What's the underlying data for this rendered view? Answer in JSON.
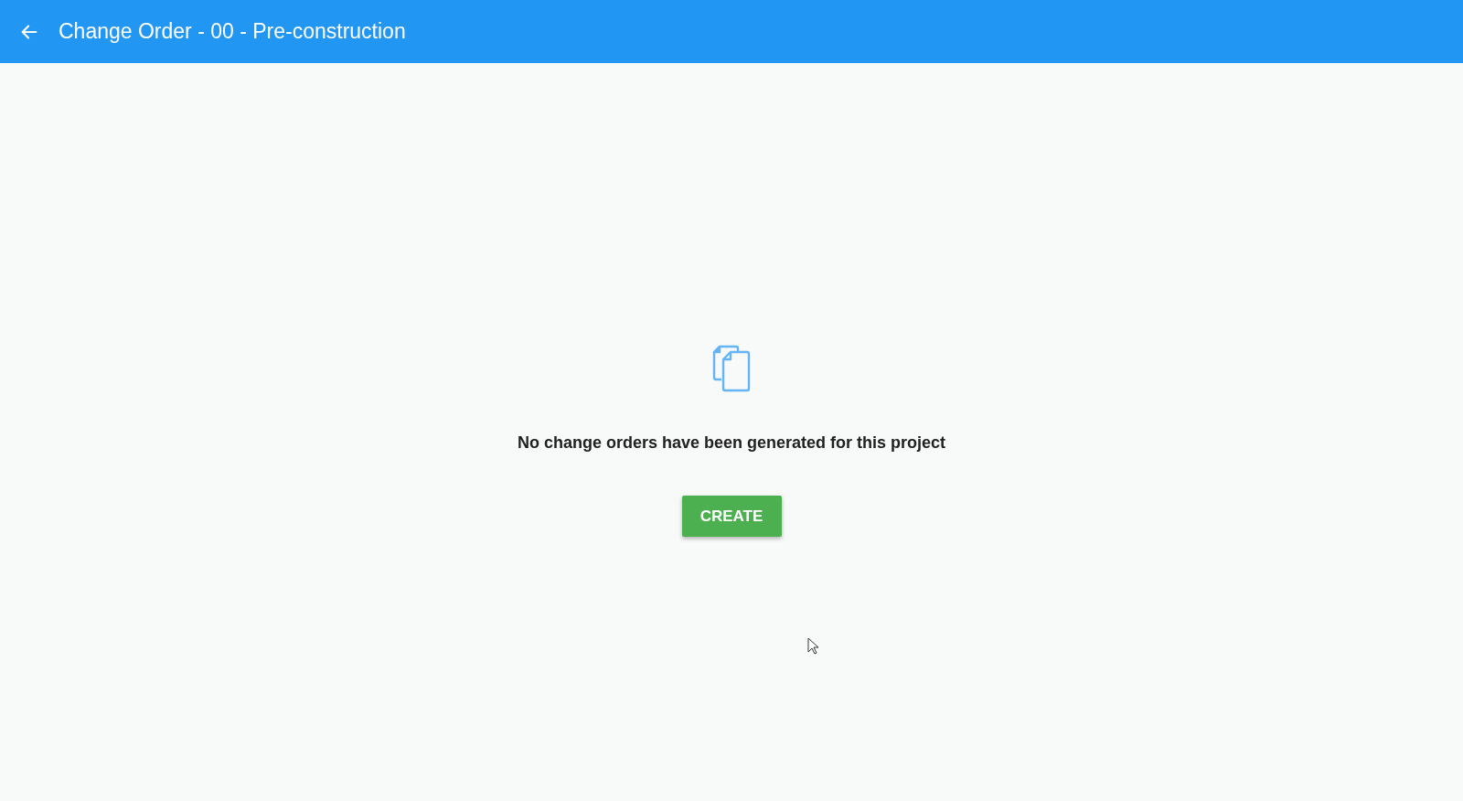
{
  "header": {
    "title": "Change Order - 00 - Pre-construction"
  },
  "empty_state": {
    "message": "No change orders have been generated for this project",
    "button": "CREATE"
  }
}
